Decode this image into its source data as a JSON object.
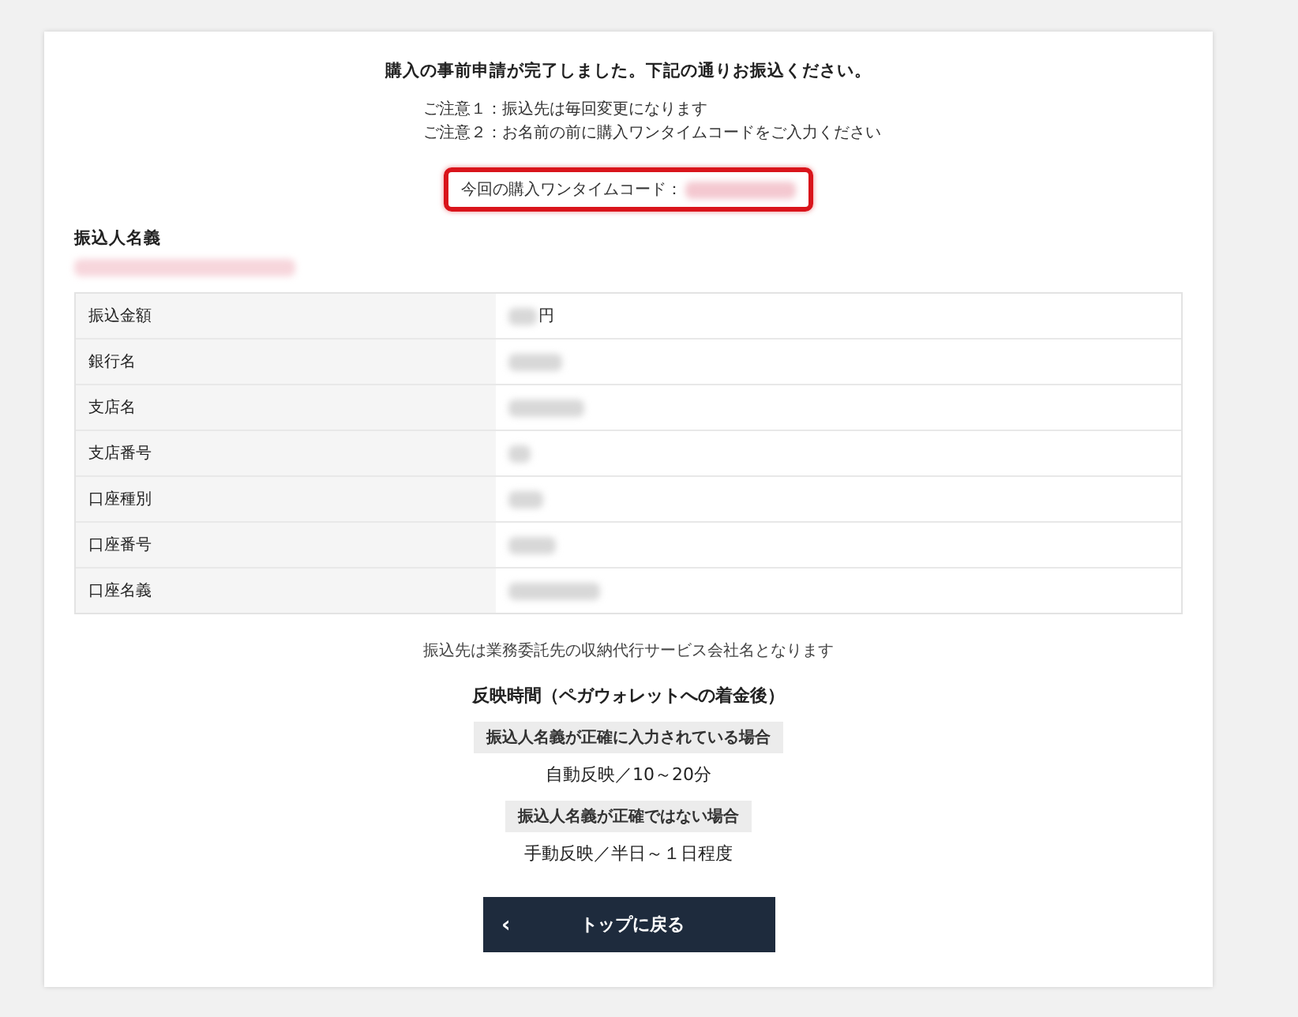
{
  "title": "購入の事前申請が完了しました。下記の通りお振込ください。",
  "notes": [
    "ご注意１：振込先は毎回変更になります",
    "ご注意２：お名前の前に購入ワンタイムコードをご入力ください"
  ],
  "one_time_code": {
    "label": "今回の購入ワンタイムコード："
  },
  "payer_name": {
    "label": "振込人名義"
  },
  "table": {
    "rows": [
      {
        "label": "振込金額",
        "suffix": "円"
      },
      {
        "label": "銀行名"
      },
      {
        "label": "支店名"
      },
      {
        "label": "支店番号"
      },
      {
        "label": "口座種別"
      },
      {
        "label": "口座番号"
      },
      {
        "label": "口座名義"
      }
    ]
  },
  "footnote": "振込先は業務委託先の収納代行サービス会社名となります",
  "reflection": {
    "heading": "反映時間（ペガウォレットへの着金後）",
    "cases": [
      {
        "condition": "振込人名義が正確に入力されている場合",
        "result": "自動反映／10～20分"
      },
      {
        "condition": "振込人名義が正確ではない場合",
        "result": "手動反映／半日～１日程度"
      }
    ]
  },
  "back_button": {
    "icon": "‹",
    "label": "トップに戻る"
  }
}
